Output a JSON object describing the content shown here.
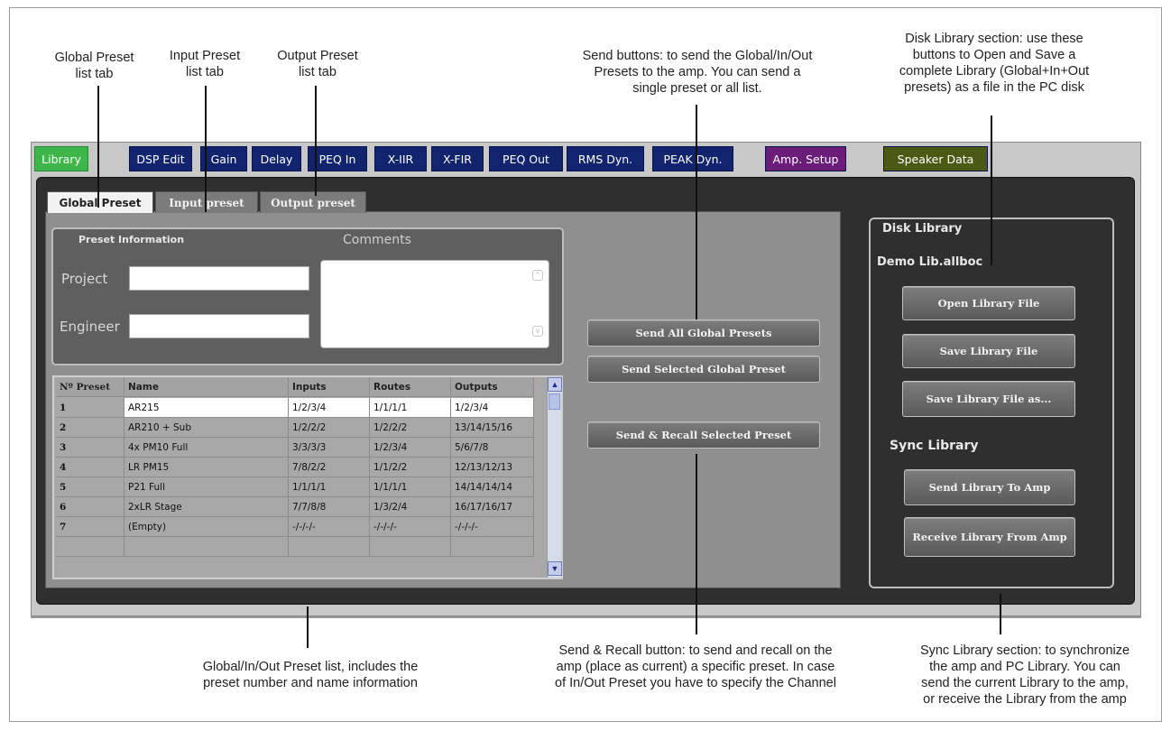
{
  "annotations": {
    "global_tab": "Global Preset\nlist tab",
    "input_tab": "Input Preset\nlist tab",
    "output_tab": "Output Preset\nlist tab",
    "send_buttons": "Send buttons: to send the Global/In/Out\nPresets to the amp. You can send a\nsingle preset or all list.",
    "disk_library": "Disk Library section: use these\nbuttons to Open and Save a\ncomplete Library (Global+In+Out\npresets) as a file in the PC disk",
    "preset_list": "Global/In/Out Preset list, includes the\npreset number and name information",
    "send_recall": "Send & Recall button: to send and recall on the\namp (place as current) a specific preset.  In case\nof In/Out Preset you have to specify the Channel",
    "sync_library": "Sync Library section: to synchronize\nthe amp and PC Library. You can\nsend the current Library to the amp,\nor receive the Library from the amp"
  },
  "main_tabs": [
    "Library",
    "DSP Edit",
    "Gain",
    "Delay",
    "PEQ In",
    "X-IIR",
    "X-FIR",
    "PEQ Out",
    "RMS Dyn.",
    "PEAK Dyn.",
    "Amp. Setup",
    "Speaker Data"
  ],
  "sub_tabs": [
    "Global Preset",
    "Input preset",
    "Output preset"
  ],
  "preset_info": {
    "title": "Preset Information",
    "comments_label": "Comments",
    "project_label": "Project",
    "engineer_label": "Engineer",
    "project_value": "",
    "engineer_value": "",
    "comments_value": ""
  },
  "table": {
    "headers": [
      "Nº Preset",
      "Name",
      "Inputs",
      "Routes",
      "Outputs"
    ],
    "rows": [
      [
        "1",
        "AR215",
        "1/2/3/4",
        "1/1/1/1",
        "1/2/3/4"
      ],
      [
        "2",
        "AR210 + Sub",
        "1/2/2/2",
        "1/2/2/2",
        "13/14/15/16"
      ],
      [
        "3",
        "4x PM10 Full",
        "3/3/3/3",
        "1/2/3/4",
        "5/6/7/8"
      ],
      [
        "4",
        "LR PM15",
        "7/8/2/2",
        "1/1/2/2",
        "12/13/12/13"
      ],
      [
        "5",
        "P21 Full",
        "1/1/1/1",
        "1/1/1/1",
        "14/14/14/14"
      ],
      [
        "6",
        "2xLR Stage",
        "7/7/8/8",
        "1/3/2/4",
        "16/17/16/17"
      ],
      [
        "7",
        "(Empty)",
        "-/-/-/-",
        "-/-/-/-",
        "-/-/-/-"
      ]
    ]
  },
  "buttons": {
    "send_all": "Send All Global Presets",
    "send_selected": "Send Selected Global Preset",
    "send_recall": "Send & Recall Selected Preset"
  },
  "disk_library": {
    "title": "Disk Library",
    "filename": "Demo Lib.allboc",
    "open": "Open Library File",
    "save": "Save Library File",
    "save_as": "Save Library File as...",
    "sync_title": "Sync Library",
    "send": "Send Library To Amp",
    "receive": "Receive Library From Amp"
  }
}
